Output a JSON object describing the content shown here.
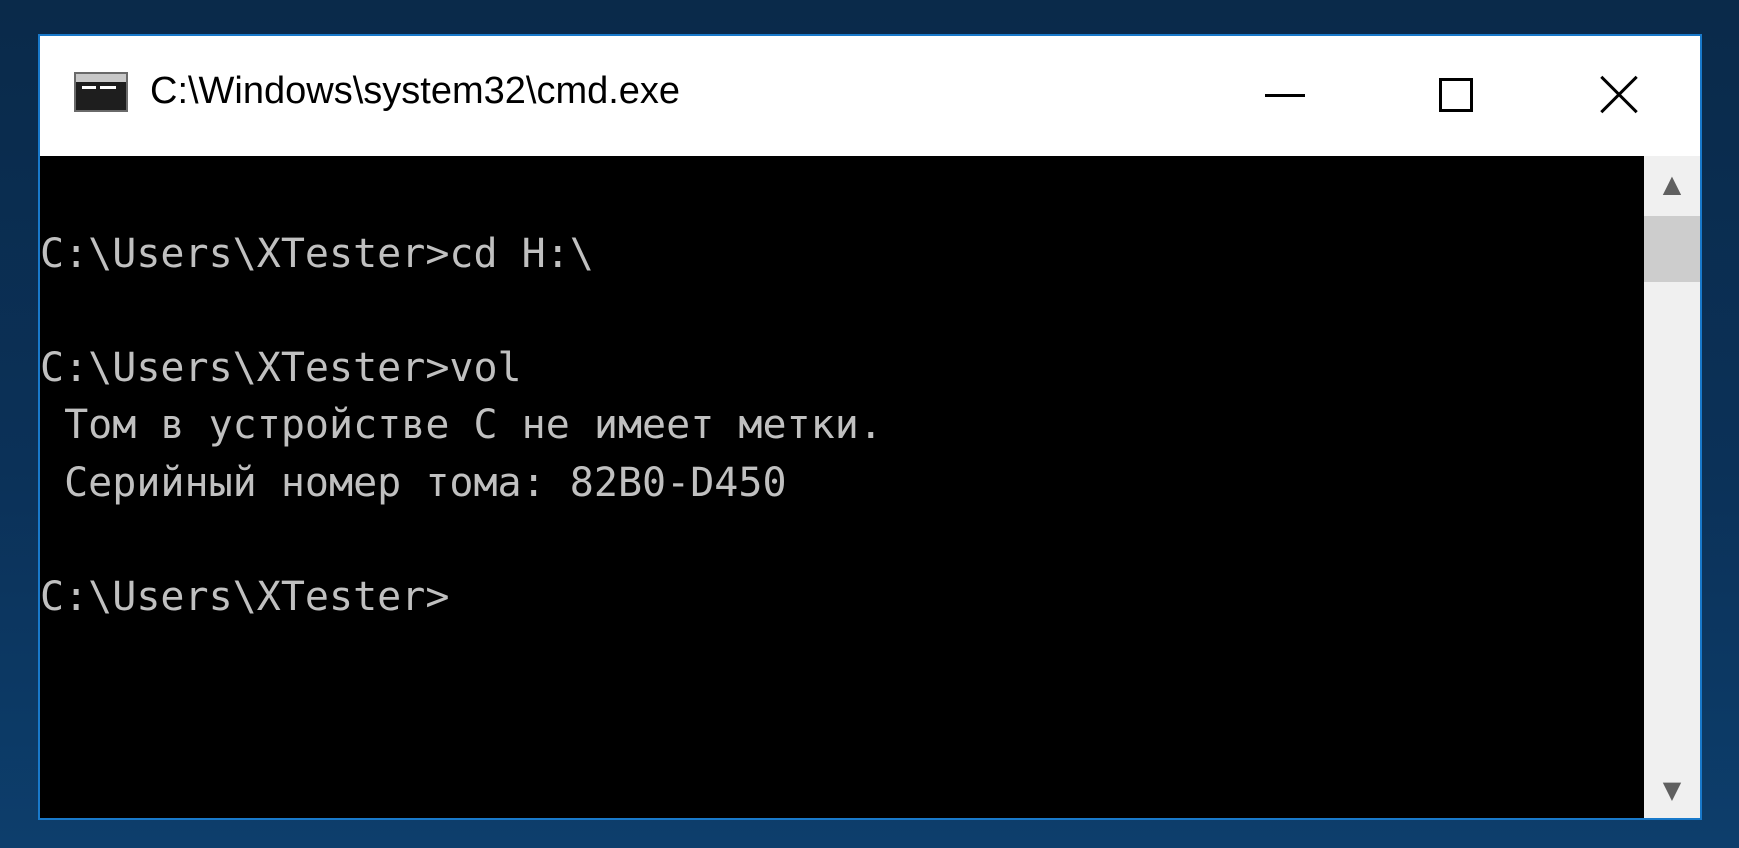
{
  "window": {
    "title": "C:\\Windows\\system32\\cmd.exe",
    "app_icon": "cmd-icon"
  },
  "controls": {
    "minimize": "minimize-icon",
    "maximize": "maximize-icon",
    "close": "close-icon"
  },
  "console": {
    "lines": [
      "C:\\Users\\XTester>cd H:\\",
      "",
      "C:\\Users\\XTester>vol",
      " Том в устройстве C не имеет метки.",
      " Серийный номер тома: 82B0-D450",
      "",
      "C:\\Users\\XTester>"
    ],
    "text_color": "#c0c0c0",
    "background": "#000000"
  },
  "scrollbar": {
    "up_arrow": "▲",
    "down_arrow": "▼"
  },
  "colors": {
    "window_border": "#1979ca",
    "titlebar": "#ffffff"
  }
}
